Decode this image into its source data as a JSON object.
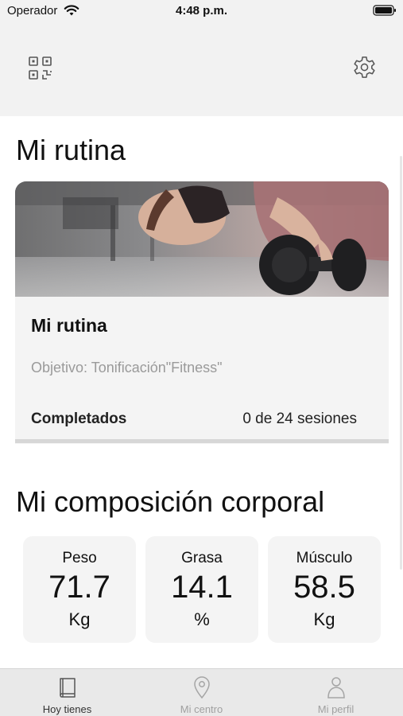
{
  "status_bar": {
    "carrier": "Operador",
    "time": "4:48 p.m."
  },
  "toolbar": {
    "left_icon": "qr-code-icon",
    "right_icon": "gear-icon"
  },
  "routine_section": {
    "title": "Mi rutina",
    "card": {
      "name": "Mi rutina",
      "goal": "Objetivo: Tonificación\"Fitness\"",
      "completed_label": "Completados",
      "completed_value": "0 de 24 sesiones",
      "progress_fraction": 0
    }
  },
  "body_section": {
    "title": "Mi composición corporal",
    "metrics": [
      {
        "label": "Peso",
        "value": "71.7",
        "unit": "Kg"
      },
      {
        "label": "Grasa",
        "value": "14.1",
        "unit": "%"
      },
      {
        "label": "Músculo",
        "value": "58.5",
        "unit": "Kg"
      }
    ]
  },
  "tab_bar": {
    "tabs": [
      {
        "label": "Hoy tienes",
        "icon": "book-icon",
        "active": true
      },
      {
        "label": "Mi centro",
        "icon": "location-pin-icon",
        "active": false
      },
      {
        "label": "Mi perfil",
        "icon": "person-icon",
        "active": false
      }
    ]
  },
  "colors": {
    "background": "#f2f2f2",
    "card": "#f4f4f4",
    "muted_text": "#9a9a9a",
    "tab_bar": "#e9e9e9"
  }
}
